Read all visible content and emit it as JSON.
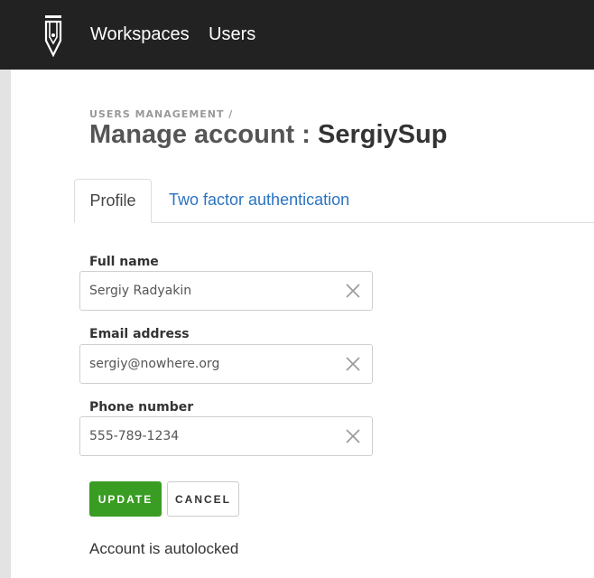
{
  "nav": {
    "logo_icon": "pen-nib-logo-icon",
    "items": [
      {
        "label": "Workspaces"
      },
      {
        "label": "Users"
      }
    ]
  },
  "breadcrumb": "USERS MANAGEMENT /",
  "title": {
    "prefix": "Manage account : ",
    "username": "SergiySup"
  },
  "tabs": [
    {
      "label": "Profile",
      "active": true
    },
    {
      "label": "Two factor authentication",
      "active": false
    }
  ],
  "form": {
    "full_name": {
      "label": "Full name",
      "value": "Sergiy Radyakin"
    },
    "email": {
      "label": "Email address",
      "value": "sergiy@nowhere.org"
    },
    "phone": {
      "label": "Phone number",
      "value": "555-789-1234"
    },
    "clear_icon": "close-icon"
  },
  "buttons": {
    "update": "UPDATE",
    "cancel": "CANCEL"
  },
  "status": "Account is autolocked",
  "colors": {
    "topbar": "#222222",
    "accent_green": "#3a9d23",
    "link_blue": "#2a73c2"
  }
}
